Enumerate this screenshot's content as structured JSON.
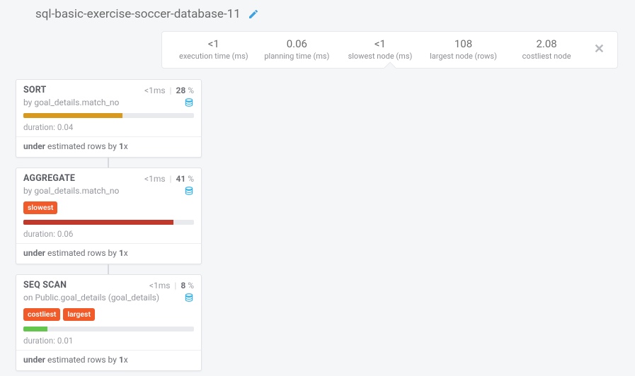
{
  "title": "sql-basic-exercise-soccer-database-11",
  "stats": [
    {
      "value": "<1",
      "label": "execution time (ms)"
    },
    {
      "value": "0.06",
      "label": "planning time (ms)"
    },
    {
      "value": "<1",
      "label": "slowest node (ms)"
    },
    {
      "value": "108",
      "label": "largest node (rows)"
    },
    {
      "value": "2.08",
      "label": "costliest node"
    }
  ],
  "nodes": [
    {
      "title": "SORT",
      "time": "<1",
      "time_unit": "ms",
      "percent": "28",
      "sub_prefix": "by",
      "sub": "goal_details.match_no",
      "tags": [],
      "bar_class": "bar-orange",
      "bar_width": "58%",
      "duration": "0.04",
      "est_bold1": "under",
      "est_text": " estimated rows by ",
      "est_bold2": "1",
      "est_suffix": "x"
    },
    {
      "title": "AGGREGATE",
      "time": "<1",
      "time_unit": "ms",
      "percent": "41",
      "sub_prefix": "by",
      "sub": "goal_details.match_no",
      "tags": [
        "slowest"
      ],
      "bar_class": "bar-red",
      "bar_width": "88%",
      "duration": "0.06",
      "est_bold1": "under",
      "est_text": " estimated rows by ",
      "est_bold2": "1",
      "est_suffix": "x"
    },
    {
      "title": "SEQ SCAN",
      "time": "<1",
      "time_unit": "ms",
      "percent": "8",
      "sub_prefix": "on",
      "sub": "Public.goal_details (goal_details)",
      "tags": [
        "costliest",
        "largest"
      ],
      "bar_class": "bar-green",
      "bar_width": "14%",
      "duration": "0.01",
      "est_bold1": "under",
      "est_text": " estimated rows by ",
      "est_bold2": "1",
      "est_suffix": "x"
    }
  ],
  "labels": {
    "duration_prefix": "duration: "
  }
}
